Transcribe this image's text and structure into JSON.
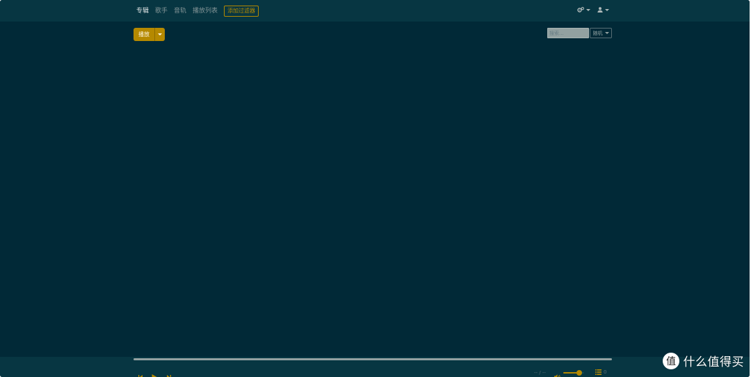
{
  "nav": {
    "items": [
      {
        "label": "专辑",
        "active": true
      },
      {
        "label": "歌手",
        "active": false
      },
      {
        "label": "音轨",
        "active": false
      },
      {
        "label": "播放列表",
        "active": false
      }
    ],
    "add_filter_label": "添加过滤器",
    "right_icons": [
      "settings-gears-icon",
      "user-icon"
    ]
  },
  "toolbar": {
    "play_label": "播放",
    "search_placeholder": "搜索...",
    "random_label": "随机"
  },
  "player": {
    "time": "-- / --",
    "volume_percent": 75,
    "queue_count": "0"
  },
  "watermark": {
    "text": "什么值得买",
    "logo_char": "值"
  },
  "colors": {
    "background": "#012937",
    "bar": "#073642",
    "accent": "#b58900"
  }
}
